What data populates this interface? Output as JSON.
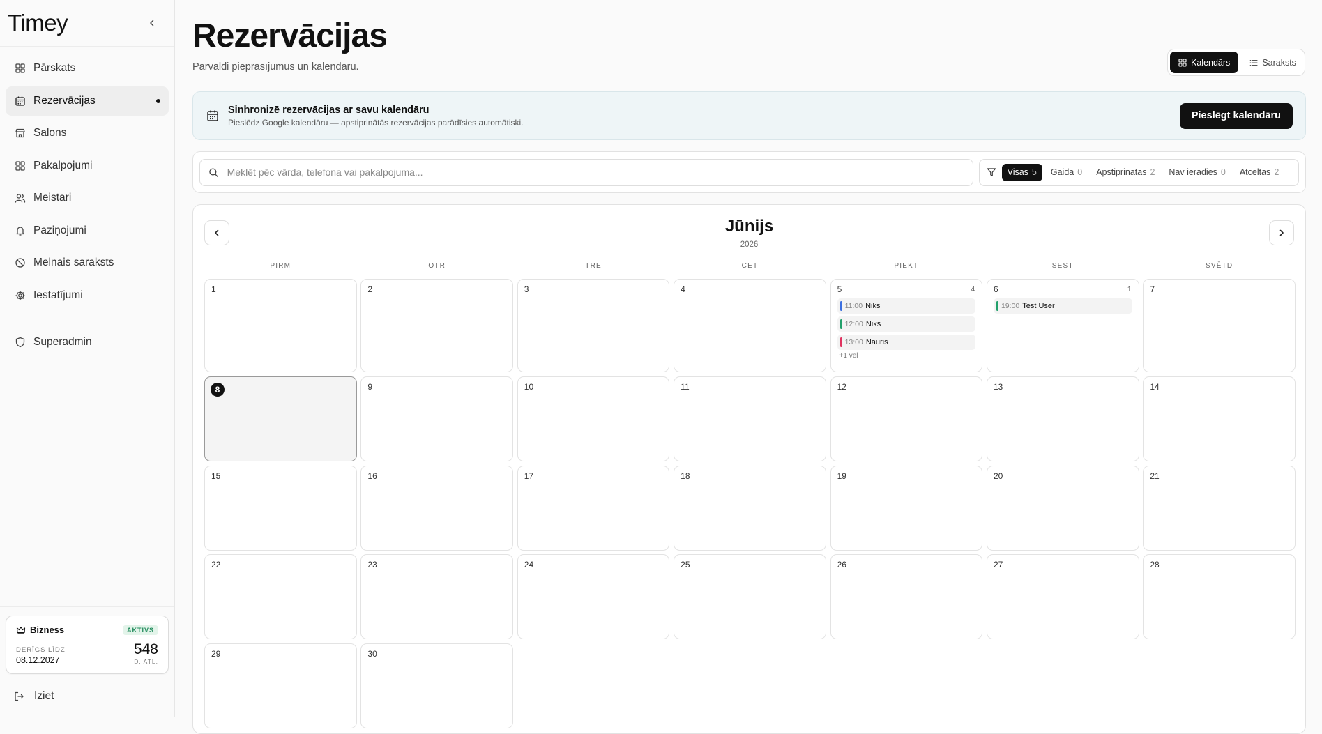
{
  "sidebar": {
    "brand": "Timey",
    "items": [
      {
        "label": "Pārskats",
        "icon": "grid-icon"
      },
      {
        "label": "Rezervācijas",
        "icon": "calendar-icon"
      },
      {
        "label": "Salons",
        "icon": "store-icon"
      },
      {
        "label": "Pakalpojumi",
        "icon": "grid-icon"
      },
      {
        "label": "Meistari",
        "icon": "users-icon"
      },
      {
        "label": "Paziņojumi",
        "icon": "bell-icon"
      },
      {
        "label": "Melnais saraksts",
        "icon": "ban-icon"
      },
      {
        "label": "Iestatījumi",
        "icon": "gear-icon"
      },
      {
        "label": "Superadmin",
        "icon": "shield-icon"
      }
    ],
    "active_index": 1,
    "plan": {
      "name": "Bizness",
      "badge": "AKTĪVS",
      "valid_label": "DERĪGS LĪDZ",
      "valid_date": "08.12.2027",
      "days_left": "548",
      "days_label": "D. ATL."
    },
    "logout": "Iziet"
  },
  "header": {
    "title": "Rezervācijas",
    "subtitle": "Pārvaldi pieprasījumus un kalendāru.",
    "views": [
      {
        "label": "Kalendārs",
        "icon": "grid-icon",
        "active": true
      },
      {
        "label": "Saraksts",
        "icon": "list-icon",
        "active": false
      }
    ]
  },
  "sync": {
    "title": "Sinhronizē rezervācijas ar savu kalendāru",
    "text": "Pieslēdz Google kalendāru — apstiprinātās rezervācijas parādīsies automātiski.",
    "button": "Pieslēgt kalendāru"
  },
  "search": {
    "placeholder": "Meklēt pēc vārda, telefona vai pakalpojuma...",
    "value": ""
  },
  "filters": [
    {
      "label": "Visas",
      "count": "5",
      "active": true
    },
    {
      "label": "Gaida",
      "count": "0",
      "active": false
    },
    {
      "label": "Apstiprinātas",
      "count": "2",
      "active": false
    },
    {
      "label": "Nav ieradies",
      "count": "0",
      "active": false
    },
    {
      "label": "Atceltas",
      "count": "2",
      "active": false
    }
  ],
  "calendar": {
    "month": "Jūnijs",
    "year": "2026",
    "weekdays": [
      "PIRM",
      "OTR",
      "TRE",
      "CET",
      "PIEKT",
      "SEST",
      "SVĒTD"
    ],
    "today": 8,
    "days": [
      {
        "num": "1"
      },
      {
        "num": "2"
      },
      {
        "num": "3"
      },
      {
        "num": "4"
      },
      {
        "num": "5",
        "count": "4",
        "events": [
          {
            "time": "11:00",
            "name": "Niks",
            "color": "#3b6fe0"
          },
          {
            "time": "12:00",
            "name": "Niks",
            "color": "#22a06b"
          },
          {
            "time": "13:00",
            "name": "Nauris",
            "color": "#e0325f"
          }
        ],
        "more": "+1 vēl"
      },
      {
        "num": "6",
        "count": "1",
        "events": [
          {
            "time": "19:00",
            "name": "Test User",
            "color": "#22a06b"
          }
        ]
      },
      {
        "num": "7"
      },
      {
        "num": "8"
      },
      {
        "num": "9"
      },
      {
        "num": "10"
      },
      {
        "num": "11"
      },
      {
        "num": "12"
      },
      {
        "num": "13"
      },
      {
        "num": "14"
      },
      {
        "num": "15"
      },
      {
        "num": "16"
      },
      {
        "num": "17"
      },
      {
        "num": "18"
      },
      {
        "num": "19"
      },
      {
        "num": "20"
      },
      {
        "num": "21"
      },
      {
        "num": "22"
      },
      {
        "num": "23"
      },
      {
        "num": "24"
      },
      {
        "num": "25"
      },
      {
        "num": "26"
      },
      {
        "num": "27"
      },
      {
        "num": "28"
      },
      {
        "num": "29"
      },
      {
        "num": "30"
      }
    ]
  }
}
